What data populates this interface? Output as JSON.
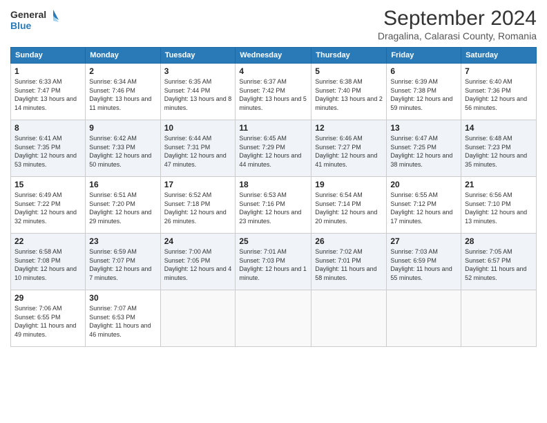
{
  "header": {
    "logo_line1": "General",
    "logo_line2": "Blue",
    "month_title": "September 2024",
    "subtitle": "Dragalina, Calarasi County, Romania"
  },
  "days_of_week": [
    "Sunday",
    "Monday",
    "Tuesday",
    "Wednesday",
    "Thursday",
    "Friday",
    "Saturday"
  ],
  "weeks": [
    [
      {
        "day": "1",
        "sunrise": "6:33 AM",
        "sunset": "7:47 PM",
        "daylight": "13 hours and 14 minutes."
      },
      {
        "day": "2",
        "sunrise": "6:34 AM",
        "sunset": "7:46 PM",
        "daylight": "13 hours and 11 minutes."
      },
      {
        "day": "3",
        "sunrise": "6:35 AM",
        "sunset": "7:44 PM",
        "daylight": "13 hours and 8 minutes."
      },
      {
        "day": "4",
        "sunrise": "6:37 AM",
        "sunset": "7:42 PM",
        "daylight": "13 hours and 5 minutes."
      },
      {
        "day": "5",
        "sunrise": "6:38 AM",
        "sunset": "7:40 PM",
        "daylight": "13 hours and 2 minutes."
      },
      {
        "day": "6",
        "sunrise": "6:39 AM",
        "sunset": "7:38 PM",
        "daylight": "12 hours and 59 minutes."
      },
      {
        "day": "7",
        "sunrise": "6:40 AM",
        "sunset": "7:36 PM",
        "daylight": "12 hours and 56 minutes."
      }
    ],
    [
      {
        "day": "8",
        "sunrise": "6:41 AM",
        "sunset": "7:35 PM",
        "daylight": "12 hours and 53 minutes."
      },
      {
        "day": "9",
        "sunrise": "6:42 AM",
        "sunset": "7:33 PM",
        "daylight": "12 hours and 50 minutes."
      },
      {
        "day": "10",
        "sunrise": "6:44 AM",
        "sunset": "7:31 PM",
        "daylight": "12 hours and 47 minutes."
      },
      {
        "day": "11",
        "sunrise": "6:45 AM",
        "sunset": "7:29 PM",
        "daylight": "12 hours and 44 minutes."
      },
      {
        "day": "12",
        "sunrise": "6:46 AM",
        "sunset": "7:27 PM",
        "daylight": "12 hours and 41 minutes."
      },
      {
        "day": "13",
        "sunrise": "6:47 AM",
        "sunset": "7:25 PM",
        "daylight": "12 hours and 38 minutes."
      },
      {
        "day": "14",
        "sunrise": "6:48 AM",
        "sunset": "7:23 PM",
        "daylight": "12 hours and 35 minutes."
      }
    ],
    [
      {
        "day": "15",
        "sunrise": "6:49 AM",
        "sunset": "7:22 PM",
        "daylight": "12 hours and 32 minutes."
      },
      {
        "day": "16",
        "sunrise": "6:51 AM",
        "sunset": "7:20 PM",
        "daylight": "12 hours and 29 minutes."
      },
      {
        "day": "17",
        "sunrise": "6:52 AM",
        "sunset": "7:18 PM",
        "daylight": "12 hours and 26 minutes."
      },
      {
        "day": "18",
        "sunrise": "6:53 AM",
        "sunset": "7:16 PM",
        "daylight": "12 hours and 23 minutes."
      },
      {
        "day": "19",
        "sunrise": "6:54 AM",
        "sunset": "7:14 PM",
        "daylight": "12 hours and 20 minutes."
      },
      {
        "day": "20",
        "sunrise": "6:55 AM",
        "sunset": "7:12 PM",
        "daylight": "12 hours and 17 minutes."
      },
      {
        "day": "21",
        "sunrise": "6:56 AM",
        "sunset": "7:10 PM",
        "daylight": "12 hours and 13 minutes."
      }
    ],
    [
      {
        "day": "22",
        "sunrise": "6:58 AM",
        "sunset": "7:08 PM",
        "daylight": "12 hours and 10 minutes."
      },
      {
        "day": "23",
        "sunrise": "6:59 AM",
        "sunset": "7:07 PM",
        "daylight": "12 hours and 7 minutes."
      },
      {
        "day": "24",
        "sunrise": "7:00 AM",
        "sunset": "7:05 PM",
        "daylight": "12 hours and 4 minutes."
      },
      {
        "day": "25",
        "sunrise": "7:01 AM",
        "sunset": "7:03 PM",
        "daylight": "12 hours and 1 minute."
      },
      {
        "day": "26",
        "sunrise": "7:02 AM",
        "sunset": "7:01 PM",
        "daylight": "11 hours and 58 minutes."
      },
      {
        "day": "27",
        "sunrise": "7:03 AM",
        "sunset": "6:59 PM",
        "daylight": "11 hours and 55 minutes."
      },
      {
        "day": "28",
        "sunrise": "7:05 AM",
        "sunset": "6:57 PM",
        "daylight": "11 hours and 52 minutes."
      }
    ],
    [
      {
        "day": "29",
        "sunrise": "7:06 AM",
        "sunset": "6:55 PM",
        "daylight": "11 hours and 49 minutes."
      },
      {
        "day": "30",
        "sunrise": "7:07 AM",
        "sunset": "6:53 PM",
        "daylight": "11 hours and 46 minutes."
      },
      null,
      null,
      null,
      null,
      null
    ]
  ],
  "labels": {
    "sunrise": "Sunrise:",
    "sunset": "Sunset:",
    "daylight": "Daylight:"
  }
}
